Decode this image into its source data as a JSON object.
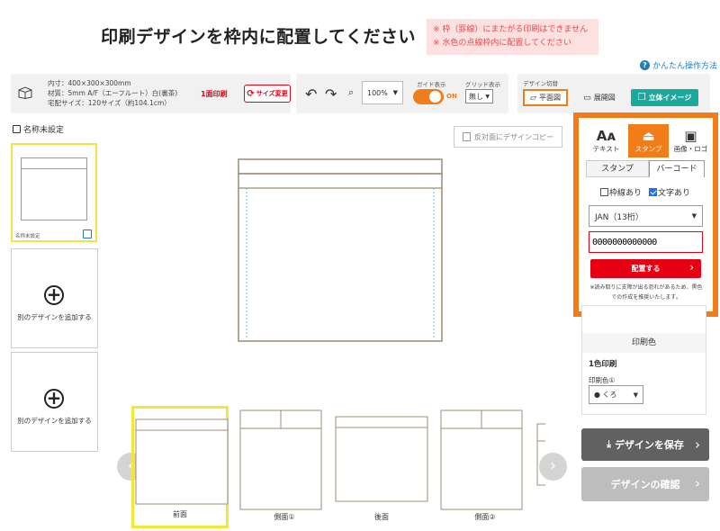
{
  "header": {
    "title": "印刷デザインを枠内に配置してください",
    "notices": [
      "※ 枠（罫線）にまたがる印刷はできません",
      "※ 水色の点線枠内に配置してください"
    ],
    "help_link": "かんたん操作方法"
  },
  "product": {
    "lines": [
      "内寸：400×300×300mm",
      "材質：5mm A/F（エーフルート）白(裏茶)",
      "宅配サイズ：120サイズ（約104.1cm）"
    ],
    "print_type": "1面印刷",
    "size_change_label": "サイズ変更"
  },
  "toolbar": {
    "undo_icon": "undo-icon",
    "redo_icon": "redo-icon",
    "zoom_value": "100%",
    "guide_label": "ガイド表示",
    "guide_state": "ON",
    "grid_label": "グリッド表示",
    "grid_value": "無し"
  },
  "view_switch": {
    "label": "デザイン切替",
    "plan": "平面図",
    "unfold": "展開図",
    "three_d": "立体イメージ"
  },
  "left": {
    "doc_name": "名称未設定",
    "thumb_name": "名称未設定",
    "add_label": "別のデザインを追加する"
  },
  "canvas": {
    "copy_button": "反対面にデザインコピー"
  },
  "tool_panel": {
    "tabs": [
      "テキスト",
      "スタンプ",
      "画像・ロゴ"
    ],
    "subtabs": [
      "スタンプ",
      "バーコード"
    ],
    "frame_checkbox": "枠線あり",
    "text_checkbox": "文字あり",
    "frame_checked": false,
    "text_checked": true,
    "barcode_type": "JAN（13桁）",
    "barcode_value": "0000000000000",
    "place_button": "配置する",
    "note": "※読み取りに支障が出る恐れがあるため、黒色での作成を推奨いたします。"
  },
  "print_color": {
    "heading": "印刷色",
    "count": "1色印刷",
    "color_label": "印刷色①",
    "color_value": "● くろ"
  },
  "actions": {
    "save": "デザインを保存",
    "confirm": "デザインの確認"
  },
  "faces": [
    "前面",
    "側面①",
    "後面",
    "側面②"
  ],
  "colors": {
    "accent": "#f07c1a",
    "red": "#e60012",
    "teal": "#1aa99b",
    "box_line": "#9c8c72",
    "guide": "#5bc8e8",
    "highlight": "#f5e43a"
  }
}
